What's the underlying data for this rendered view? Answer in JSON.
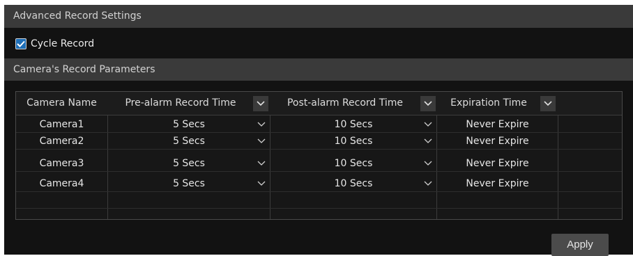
{
  "sections": {
    "advanced_title": "Advanced Record Settings",
    "params_title": "Camera's Record Parameters"
  },
  "cycle_record": {
    "label": "Cycle Record",
    "checked": true
  },
  "table": {
    "headers": {
      "camera_name": "Camera Name",
      "pre_alarm": "Pre-alarm Record Time",
      "post_alarm": "Post-alarm Record Time",
      "expiration": "Expiration Time"
    },
    "rows": [
      {
        "camera": "Camera1",
        "pre": "5 Secs",
        "post": "10 Secs",
        "expiration": "Never Expire"
      },
      {
        "camera": "Camera2",
        "pre": "5 Secs",
        "post": "10 Secs",
        "expiration": "Never Expire"
      },
      {
        "camera": "Camera3",
        "pre": "5 Secs",
        "post": "10 Secs",
        "expiration": "Never Expire"
      },
      {
        "camera": "Camera4",
        "pre": "5 Secs",
        "post": "10 Secs",
        "expiration": "Never Expire"
      }
    ]
  },
  "apply_label": "Apply",
  "colors": {
    "accent": "#1e6fb8",
    "panel": "#121212",
    "header": "#3a3a3a"
  }
}
